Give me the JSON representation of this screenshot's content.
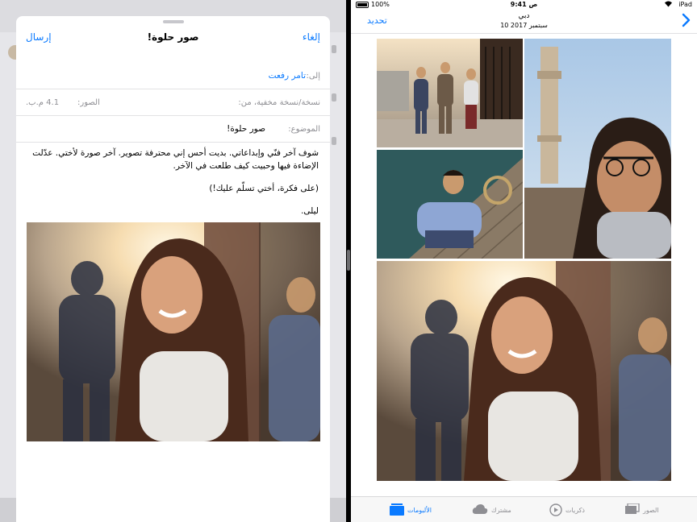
{
  "mail": {
    "cancel_label": "إلغاء",
    "title": "صور حلوة!",
    "send_label": "إرسال",
    "to_label": "إلى:",
    "to_value": "تامر رفعت",
    "cc_label": "نسخة/نسخة مخفية، من:",
    "images_label": "الصور:",
    "images_size": "4.1 م.ب.",
    "subject_label": "الموضوع:",
    "subject_value": "صور حلوة!",
    "body": [
      "شوف آخر فنّي وإبداعاتي. بديت أحس إني محترفة تصوير. آخر صورة لأختي. عدّلت الإضاءة فيها وحبيت كيف طلعت في الآخر.",
      "(على فكرة، أختي تسلّم عليك!)",
      "ليلى."
    ]
  },
  "photos": {
    "status": {
      "battery": "100%",
      "time": "9:41 ص",
      "device": "iPad"
    },
    "nav": {
      "select_label": "تحديد",
      "title": "دبي",
      "subtitle": "10 سبتمبر 2017"
    },
    "tabs": [
      {
        "id": "photos",
        "label": "الصور",
        "icon": "photos-icon"
      },
      {
        "id": "memories",
        "label": "ذكريات",
        "icon": "memories-icon"
      },
      {
        "id": "shared",
        "label": "مشترك",
        "icon": "cloud-icon"
      },
      {
        "id": "albums",
        "label": "الألبومات",
        "icon": "albums-icon"
      }
    ],
    "selected_tab": "albums"
  },
  "colors": {
    "accent": "#0a7aff",
    "inactive": "#8e8e93"
  }
}
